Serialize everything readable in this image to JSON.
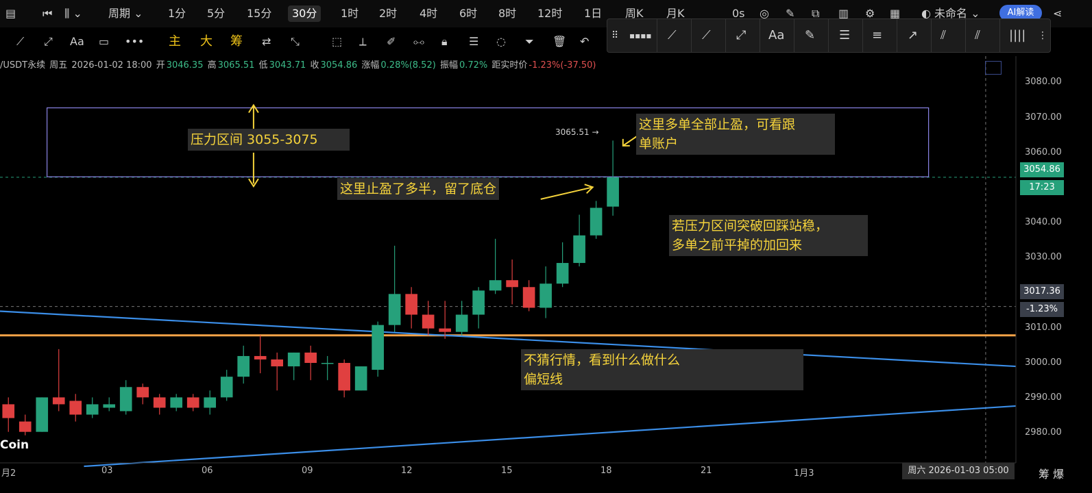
{
  "topbar": {
    "period_label": "周期",
    "intervals": [
      "1分",
      "5分",
      "15分",
      "30分",
      "1时",
      "2时",
      "4时",
      "6时",
      "8时",
      "12时",
      "1日",
      "周K",
      "月K"
    ],
    "active_interval": "30分",
    "extra": "0s",
    "account": "未命名",
    "ai_label": "AI解读"
  },
  "toolbar2": {
    "font_label": "Aa",
    "indicators": [
      "主",
      "大",
      "筹"
    ]
  },
  "drawbar": {
    "font_label": "Aa"
  },
  "info": {
    "symbol": "/USDT永续",
    "day": "周五",
    "datetime": "2026-01-02 18:00",
    "open_label": "开",
    "open": "3046.35",
    "high_label": "高",
    "high": "3065.51",
    "low_label": "低",
    "low": "3043.71",
    "close_label": "收",
    "close": "3054.86",
    "change_label": "涨幅",
    "change": "0.28%(8.52)",
    "amp_label": "振幅",
    "amp": "0.72%",
    "dist_label": "距实时价",
    "dist": "-1.23%(-37.50)"
  },
  "annotations": {
    "pressure": "压力区间 3055-3075",
    "tp_most": "这里止盈了多半，留了底仓",
    "tp_all_1": "这里多单全部止盈，可看跟",
    "tp_all_2": "单账户",
    "breakout_1": "若压力区间突破回踩站稳，",
    "breakout_2": "多单之前平掉的加回来",
    "style_1": "不猜行情，看到什么做什么",
    "style_2": "偏短线"
  },
  "price_labels": {
    "current": "3054.86",
    "countdown": "17:23",
    "crosshair": "3017.36",
    "crosshair_pct": "-1.23%",
    "peak": "3065.51 →"
  },
  "colors": {
    "up": "#26a17b",
    "down": "#e04040",
    "trendline": "#3b8ee8",
    "support": "#f5a347",
    "zone": "#8b85e6",
    "annotation_text": "#f5d33b",
    "current_price_bg": "#26a17b"
  },
  "logo": "Coin",
  "time_box": "周六 2026-01-03 05:00",
  "bottom_right": "筹 爆",
  "chart_data": {
    "type": "candlestick",
    "y_ticks": [
      3080,
      3070,
      3060,
      3050,
      3040,
      3030,
      3020,
      3010,
      3000,
      2990,
      2980
    ],
    "y_tick_labels": [
      "3080.00",
      "3070.00",
      "3060.00",
      "",
      "3040.00",
      "3030.00",
      "",
      "3010.00",
      "3000.00",
      "2990.00",
      "2980.00"
    ],
    "ylim": [
      2972,
      3090
    ],
    "x_tick_labels": [
      "月2",
      "03",
      "06",
      "09",
      "12",
      "15",
      "18",
      "21",
      "1月3"
    ],
    "x_tick_index": [
      0,
      6,
      12,
      18,
      24,
      30,
      36,
      42,
      48
    ],
    "index_range": [
      -0.5,
      60
    ],
    "candles": [
      {
        "o": 2989,
        "h": 2991,
        "l": 2981,
        "c": 2985
      },
      {
        "o": 2984,
        "h": 2986,
        "l": 2980,
        "c": 2981
      },
      {
        "o": 2981,
        "h": 2991,
        "l": 2981,
        "c": 2991
      },
      {
        "o": 2991,
        "h": 3005,
        "l": 2987,
        "c": 2989
      },
      {
        "o": 2990,
        "h": 2992,
        "l": 2984,
        "c": 2986
      },
      {
        "o": 2986,
        "h": 2991,
        "l": 2985,
        "c": 2989
      },
      {
        "o": 2988,
        "h": 2991,
        "l": 2987,
        "c": 2989
      },
      {
        "o": 2987,
        "h": 2996,
        "l": 2986,
        "c": 2994
      },
      {
        "o": 2994,
        "h": 2995,
        "l": 2989,
        "c": 2991
      },
      {
        "o": 2991,
        "h": 2992,
        "l": 2986,
        "c": 2988
      },
      {
        "o": 2988,
        "h": 2992,
        "l": 2987,
        "c": 2991
      },
      {
        "o": 2991,
        "h": 2992,
        "l": 2987,
        "c": 2988
      },
      {
        "o": 2988,
        "h": 2993,
        "l": 2986,
        "c": 2991
      },
      {
        "o": 2991,
        "h": 2999,
        "l": 2990,
        "c": 2997
      },
      {
        "o": 2997,
        "h": 3006,
        "l": 2995,
        "c": 3003
      },
      {
        "o": 3003,
        "h": 3009,
        "l": 2998,
        "c": 3002
      },
      {
        "o": 3002,
        "h": 3004,
        "l": 2993,
        "c": 3000
      },
      {
        "o": 3000,
        "h": 3004,
        "l": 2996,
        "c": 3004
      },
      {
        "o": 3004,
        "h": 3006,
        "l": 2996,
        "c": 3001
      },
      {
        "o": 3001,
        "h": 3003,
        "l": 2996,
        "c": 3001
      },
      {
        "o": 3001,
        "h": 3002,
        "l": 2991,
        "c": 2993
      },
      {
        "o": 2993,
        "h": 3000,
        "l": 2993,
        "c": 3000
      },
      {
        "o": 2999,
        "h": 3013,
        "l": 2997,
        "c": 3012
      },
      {
        "o": 3012,
        "h": 3035,
        "l": 3010,
        "c": 3021
      },
      {
        "o": 3021,
        "h": 3023,
        "l": 3011,
        "c": 3015
      },
      {
        "o": 3015,
        "h": 3019,
        "l": 3009,
        "c": 3011
      },
      {
        "o": 3011,
        "h": 3019,
        "l": 3008,
        "c": 3010
      },
      {
        "o": 3010,
        "h": 3019,
        "l": 3009,
        "c": 3015
      },
      {
        "o": 3015,
        "h": 3023,
        "l": 3011,
        "c": 3022
      },
      {
        "o": 3022,
        "h": 3037,
        "l": 3021,
        "c": 3025
      },
      {
        "o": 3025,
        "h": 3031,
        "l": 3018,
        "c": 3023
      },
      {
        "o": 3023,
        "h": 3025,
        "l": 3016,
        "c": 3017
      },
      {
        "o": 3017,
        "h": 3029,
        "l": 3014,
        "c": 3024
      },
      {
        "o": 3024,
        "h": 3036,
        "l": 3023,
        "c": 3030
      },
      {
        "o": 3030,
        "h": 3044,
        "l": 3029,
        "c": 3038
      },
      {
        "o": 3038,
        "h": 3048,
        "l": 3037,
        "c": 3046
      },
      {
        "o": 3046.35,
        "h": 3065.51,
        "l": 3043.71,
        "c": 3054.86
      }
    ],
    "zone": {
      "from": 3055,
      "to": 3075,
      "start_index": 2.3,
      "end_index": 54.8
    },
    "support_level": 3009,
    "current_price": 3054.86,
    "crosshair_price": 3017.36,
    "crosshair_index": 58.2,
    "trendlines": [
      {
        "x1": -0.5,
        "y1": 3016,
        "x2": 60,
        "y2": 3000
      },
      {
        "x1": 4.5,
        "y1": 2971,
        "x2": 60,
        "y2": 2988.5
      }
    ]
  }
}
